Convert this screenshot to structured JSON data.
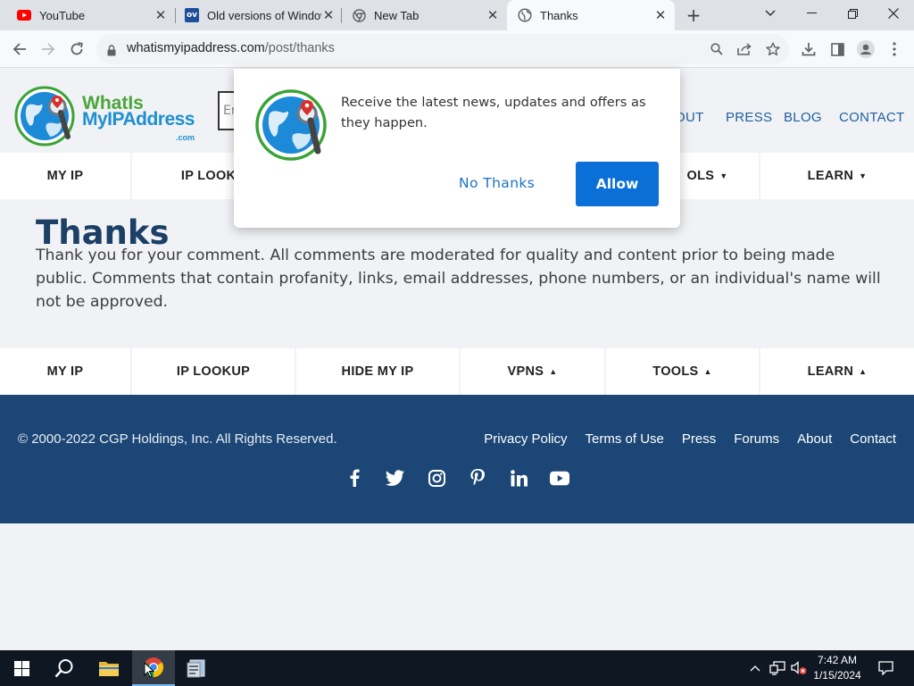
{
  "browser": {
    "tabs": [
      {
        "title": "YouTube",
        "icon": "youtube-icon"
      },
      {
        "title": "Old versions of Windows",
        "icon": "oldversion-icon",
        "icon_text": "ov"
      },
      {
        "title": "New Tab",
        "icon": "chrome-icon"
      },
      {
        "title": "Thanks",
        "icon": "globe-icon",
        "active": true
      }
    ],
    "url_domain": "whatismyipaddress.com",
    "url_path": "/post/thanks"
  },
  "site": {
    "logo": {
      "line1": "WhatIs",
      "line2": "MyIPAddress",
      "line3": ".com"
    },
    "search_placeholder": "En",
    "header_nav": [
      "OUT",
      "PRESS",
      "BLOG",
      "CONTACT"
    ],
    "main_nav": [
      {
        "label": "MY IP",
        "arrow": ""
      },
      {
        "label": "IP LOOKU",
        "arrow": ""
      },
      {
        "label": "",
        "arrow": ""
      },
      {
        "label": "",
        "arrow": ""
      },
      {
        "label": "OLS",
        "arrow": "▼"
      },
      {
        "label": "LEARN",
        "arrow": "▼"
      }
    ],
    "bottom_nav": [
      {
        "label": "MY IP",
        "arrow": ""
      },
      {
        "label": "IP LOOKUP",
        "arrow": ""
      },
      {
        "label": "HIDE MY IP",
        "arrow": ""
      },
      {
        "label": "VPNS",
        "arrow": "▲"
      },
      {
        "label": "TOOLS",
        "arrow": "▲"
      },
      {
        "label": "LEARN",
        "arrow": "▲"
      }
    ],
    "page_title": "Thanks",
    "page_body": "Thank you for your comment. All comments are moderated for quality and content prior to being made public. Comments that contain profanity, links, email addresses, phone numbers, or an individual's name will not be approved.",
    "footer": {
      "copyright": "© 2000-2022 CGP Holdings, Inc. All Rights Reserved.",
      "links": [
        "Privacy Policy",
        "Terms of Use",
        "Press",
        "Forums",
        "About",
        "Contact"
      ],
      "social": [
        "facebook-icon",
        "twitter-icon",
        "instagram-icon",
        "pinterest-icon",
        "linkedin-icon",
        "youtube-icon"
      ]
    }
  },
  "popup": {
    "message": "Receive the latest news, updates and offers as they happen.",
    "no_thanks": "No Thanks",
    "allow": "Allow"
  },
  "taskbar": {
    "time": "7:42 AM",
    "date": "1/15/2024"
  },
  "colors": {
    "brand_blue": "#1c3f66",
    "footer_bg": "#1c4675",
    "allow_button": "#0a6fd6",
    "link_blue": "#1a73c8"
  }
}
